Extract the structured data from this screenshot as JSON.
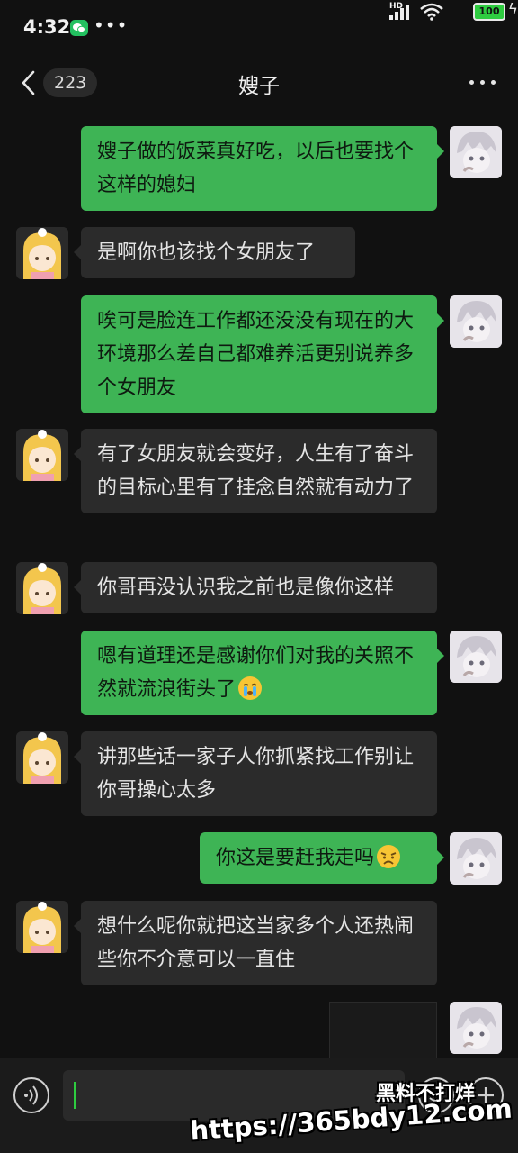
{
  "status_bar": {
    "time": "4:32",
    "hd_label": "HD",
    "battery": "100",
    "icons": [
      "wechat-icon",
      "more-dots-icon",
      "signal-icon",
      "wifi-icon",
      "battery-icon",
      "charging-icon"
    ]
  },
  "nav": {
    "back_icon": "chevron-left-icon",
    "unread_count": "223",
    "title": "嫂子",
    "more_icon": "more-icon"
  },
  "messages": [
    {
      "from": "me",
      "text": "嫂子做的饭菜真好吃，以后也要找个这样的媳妇"
    },
    {
      "from": "her",
      "text": "是啊你也该找个女朋友了"
    },
    {
      "from": "me",
      "text": "唉可是脸连工作都还没没有现在的大环境那么差自己都难养活更别说养多个女朋友"
    },
    {
      "from": "her",
      "text": "有了女朋友就会变好，人生有了奋斗的目标心里有了挂念自然就有动力了"
    },
    {
      "from": "her",
      "text": "你哥再没认识我之前也是像你这样"
    },
    {
      "from": "me",
      "text": "嗯有道理还是感谢你们对我的关照不然就流浪街头了",
      "emoji": "crying-face-emoji"
    },
    {
      "from": "her",
      "text": "讲那些话一家子人你抓紧找工作别让你哥操心太多"
    },
    {
      "from": "me",
      "text": "你这是要赶我走吗",
      "emoji": "sad-face-emoji"
    },
    {
      "from": "her",
      "text": "想什么呢你就把这当家多个人还热闹些你不介意可以一直住"
    },
    {
      "from": "me",
      "type": "media"
    }
  ],
  "input_bar": {
    "voice_icon": "voice-icon",
    "emoji_icon": "emoji-icon",
    "plus_icon": "plus-icon",
    "value": ""
  },
  "watermark": {
    "line1": "黑料不打烊",
    "line2": "https://365bdy12.com"
  },
  "colors": {
    "background": "#111111",
    "my_bubble": "#3eb455",
    "her_bubble": "#2b2b2b",
    "accent": "#2ecc40"
  }
}
